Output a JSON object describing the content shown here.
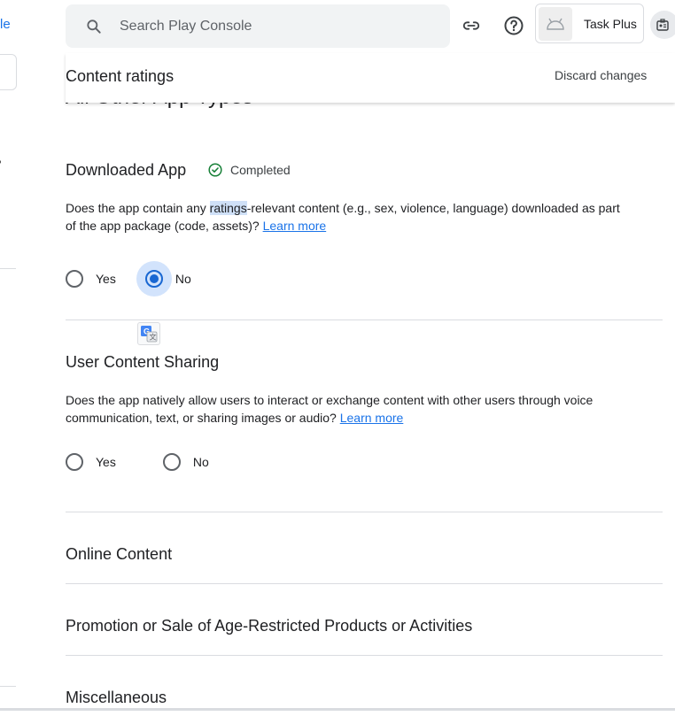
{
  "sidebar": {
    "partial_link": "le"
  },
  "search": {
    "placeholder": "Search Play Console"
  },
  "app": {
    "name": "Task Plus"
  },
  "header": {
    "title": "Content ratings",
    "discard_label": "Discard changes"
  },
  "scrolled_heading": "All Other App Types",
  "sections": [
    {
      "title": "Downloaded App",
      "status": "Completed",
      "question_pre": "Does the app contain any ",
      "question_highlight": "ratings",
      "question_post": "-relevant content (e.g., sex, violence, language) downloaded as part of the app package (code, assets)?",
      "learn_more": "Learn more",
      "yes_label": "Yes",
      "no_label": "No",
      "selected": "No"
    },
    {
      "title": "User Content Sharing",
      "question": "Does the app natively allow users to interact or exchange content with other users through voice communication, text, or sharing images or audio?",
      "learn_more": "Learn more",
      "yes_label": "Yes",
      "no_label": "No",
      "selected": ""
    },
    {
      "title": "Online Content"
    },
    {
      "title": "Promotion or Sale of Age-Restricted Products or Activities"
    },
    {
      "title": "Miscellaneous"
    }
  ],
  "colors": {
    "accent": "#1967d2",
    "link": "#1a73e8",
    "success": "#188038",
    "halo": "#d2e3fc"
  },
  "icons": [
    "search-icon",
    "link-icon",
    "help-icon",
    "android-icon",
    "account-icon",
    "check-circle-icon",
    "translate-icon"
  ]
}
